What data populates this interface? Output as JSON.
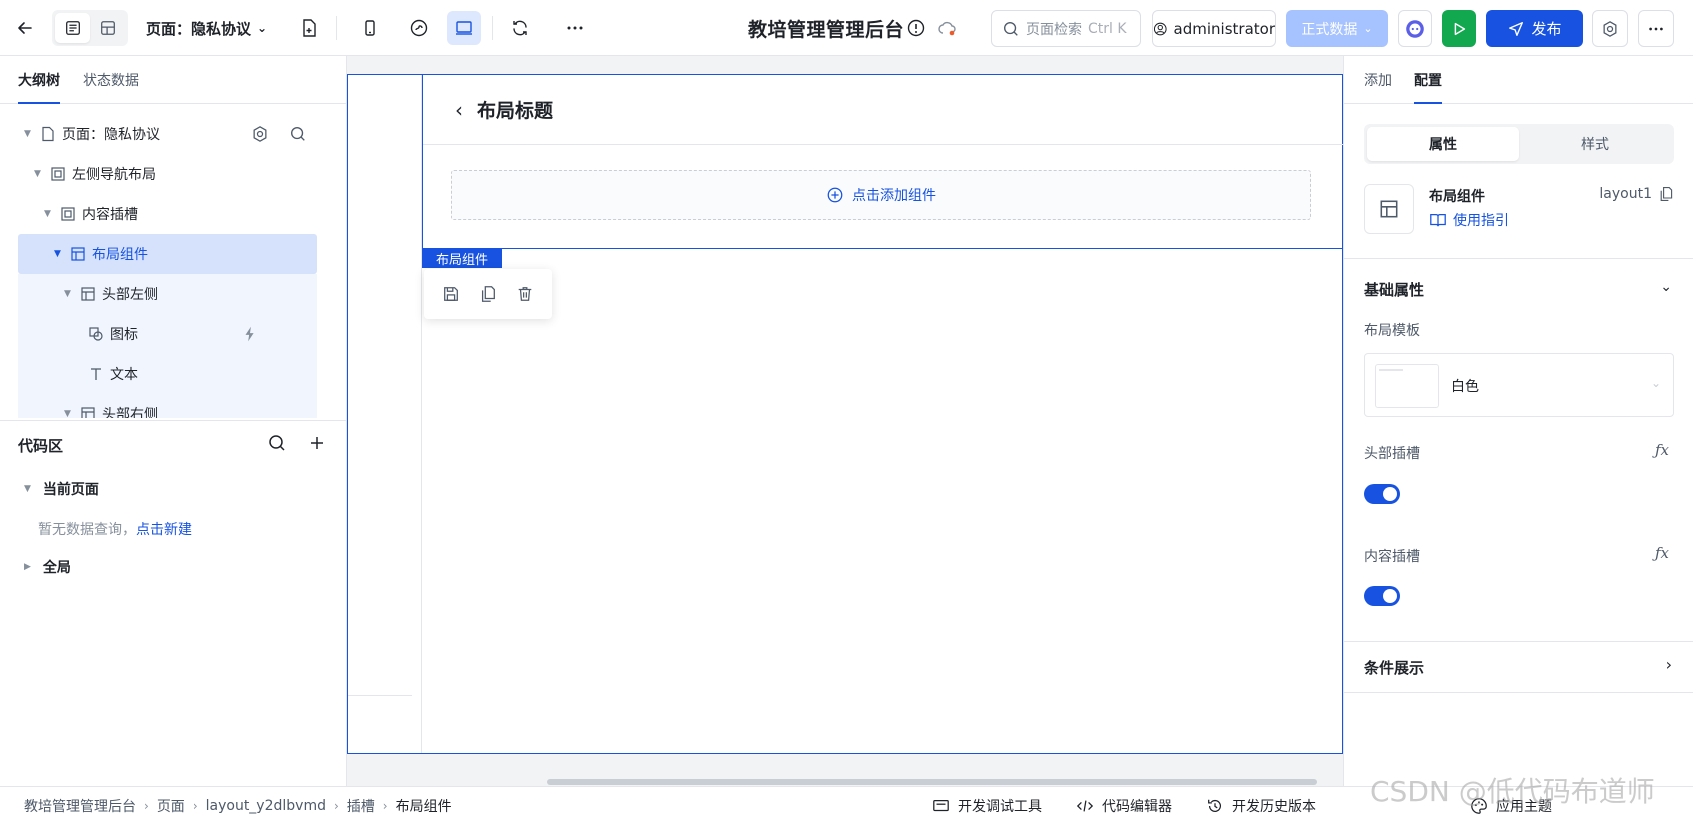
{
  "topbar": {
    "page_label": "页面：隐私协议",
    "app_title": "教培管理管理后台",
    "search_placeholder": "页面检索",
    "search_shortcut": "Ctrl K",
    "user": "administrator",
    "data_mode": "正式数据",
    "publish": "发布"
  },
  "left": {
    "tabs": [
      "大纲树",
      "状态数据"
    ],
    "tree": [
      {
        "label": "页面：隐私协议"
      },
      {
        "label": "左侧导航布局"
      },
      {
        "label": "内容插槽"
      },
      {
        "label": "布局组件"
      },
      {
        "label": "头部左侧"
      },
      {
        "label": "图标"
      },
      {
        "label": "文本"
      },
      {
        "label": "头部右侧"
      }
    ],
    "code": {
      "title": "代码区",
      "current_page": "当前页面",
      "empty_text": "暂无数据查询，",
      "create_link": "点击新建",
      "global": "全局"
    }
  },
  "canvas": {
    "layout_title": "布局标题",
    "add_component": "点击添加组件",
    "component_tag": "布局组件"
  },
  "right": {
    "tabs": [
      "添加",
      "配置"
    ],
    "seg": [
      "属性",
      "样式"
    ],
    "component_name": "布局组件",
    "component_id": "layout1",
    "guide": "使用指引",
    "basic_props": "基础属性",
    "layout_template": "布局模板",
    "template_value": "白色",
    "header_slot": "头部插槽",
    "content_slot": "内容插槽",
    "fx": "ƒx",
    "conditional": "条件展示"
  },
  "bottombar": {
    "breadcrumbs": [
      "教培管理管理后台",
      "页面",
      "layout_y2dlbvmd",
      "插槽",
      "布局组件"
    ],
    "tools": [
      "开发调试工具",
      "代码编辑器",
      "开发历史版本",
      "应用主题"
    ]
  },
  "watermark": "CSDN @低代码布道师",
  "colors": {
    "primary": "#1753e0",
    "run": "#12a84f",
    "data_btn": "#a6c2ff"
  }
}
